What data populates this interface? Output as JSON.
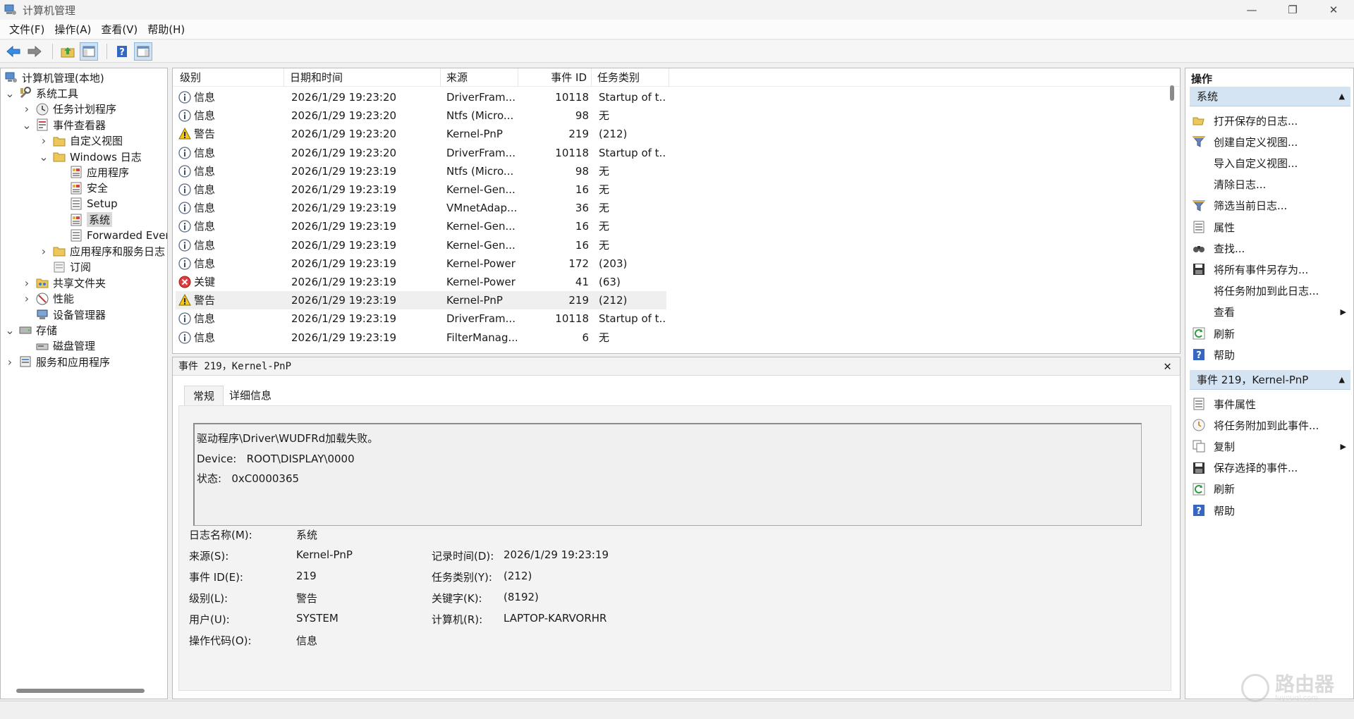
{
  "window": {
    "title": "计算机管理",
    "min": "—",
    "restore": "❐",
    "close": "✕"
  },
  "menu": [
    "文件(F)",
    "操作(A)",
    "查看(V)",
    "帮助(H)"
  ],
  "tree": [
    {
      "label": "计算机管理(本地)",
      "depth": 0,
      "chev": "",
      "icon": "computer-icon"
    },
    {
      "label": "系统工具",
      "depth": 0,
      "chev": "v",
      "icon": "tools-icon"
    },
    {
      "label": "任务计划程序",
      "depth": 1,
      "chev": ">",
      "icon": "clock-icon"
    },
    {
      "label": "事件查看器",
      "depth": 1,
      "chev": "v",
      "icon": "event-viewer-icon"
    },
    {
      "label": "自定义视图",
      "depth": 2,
      "chev": ">",
      "icon": "folder-icon"
    },
    {
      "label": "Windows 日志",
      "depth": 2,
      "chev": "v",
      "icon": "folder-icon"
    },
    {
      "label": "应用程序",
      "depth": 3,
      "chev": "",
      "icon": "log-icon"
    },
    {
      "label": "安全",
      "depth": 3,
      "chev": "",
      "icon": "log-icon"
    },
    {
      "label": "Setup",
      "depth": 3,
      "chev": "",
      "icon": "log-plain-icon"
    },
    {
      "label": "系统",
      "depth": 3,
      "chev": "",
      "icon": "log-icon",
      "selected": true
    },
    {
      "label": "Forwarded Even",
      "depth": 3,
      "chev": "",
      "icon": "log-plain-icon"
    },
    {
      "label": "应用程序和服务日志",
      "depth": 2,
      "chev": ">",
      "icon": "folder-icon"
    },
    {
      "label": "订阅",
      "depth": 2,
      "chev": "",
      "icon": "subscription-icon"
    },
    {
      "label": "共享文件夹",
      "depth": 1,
      "chev": ">",
      "icon": "shared-folder-icon"
    },
    {
      "label": "性能",
      "depth": 1,
      "chev": ">",
      "icon": "performance-icon"
    },
    {
      "label": "设备管理器",
      "depth": 1,
      "chev": "",
      "icon": "device-manager-icon"
    },
    {
      "label": "存储",
      "depth": 0,
      "chev": "v",
      "icon": "storage-icon"
    },
    {
      "label": "磁盘管理",
      "depth": 1,
      "chev": "",
      "icon": "disk-icon"
    },
    {
      "label": "服务和应用程序",
      "depth": 0,
      "chev": ">",
      "icon": "services-icon"
    }
  ],
  "grid": {
    "headers": [
      "级别",
      "日期和时间",
      "来源",
      "事件 ID",
      "任务类别"
    ],
    "rows": [
      {
        "level": "信息",
        "type": "info",
        "time": "2026/1/29 19:23:20",
        "source": "DriverFram...",
        "id": "10118",
        "task": "Startup of t..."
      },
      {
        "level": "信息",
        "type": "info",
        "time": "2026/1/29 19:23:20",
        "source": "Ntfs (Micro...",
        "id": "98",
        "task": "无"
      },
      {
        "level": "警告",
        "type": "warning",
        "time": "2026/1/29 19:23:20",
        "source": "Kernel-PnP",
        "id": "219",
        "task": "(212)"
      },
      {
        "level": "信息",
        "type": "info",
        "time": "2026/1/29 19:23:20",
        "source": "DriverFram...",
        "id": "10118",
        "task": "Startup of t..."
      },
      {
        "level": "信息",
        "type": "info",
        "time": "2026/1/29 19:23:19",
        "source": "Ntfs (Micro...",
        "id": "98",
        "task": "无"
      },
      {
        "level": "信息",
        "type": "info",
        "time": "2026/1/29 19:23:19",
        "source": "Kernel-Gen...",
        "id": "16",
        "task": "无"
      },
      {
        "level": "信息",
        "type": "info",
        "time": "2026/1/29 19:23:19",
        "source": "VMnetAdap...",
        "id": "36",
        "task": "无"
      },
      {
        "level": "信息",
        "type": "info",
        "time": "2026/1/29 19:23:19",
        "source": "Kernel-Gen...",
        "id": "16",
        "task": "无"
      },
      {
        "level": "信息",
        "type": "info",
        "time": "2026/1/29 19:23:19",
        "source": "Kernel-Gen...",
        "id": "16",
        "task": "无"
      },
      {
        "level": "信息",
        "type": "info",
        "time": "2026/1/29 19:23:19",
        "source": "Kernel-Power",
        "id": "172",
        "task": "(203)"
      },
      {
        "level": "关键",
        "type": "critical",
        "time": "2026/1/29 19:23:19",
        "source": "Kernel-Power",
        "id": "41",
        "task": "(63)"
      },
      {
        "level": "警告",
        "type": "warning",
        "time": "2026/1/29 19:23:19",
        "source": "Kernel-PnP",
        "id": "219",
        "task": "(212)",
        "highlight": true
      },
      {
        "level": "信息",
        "type": "info",
        "time": "2026/1/29 19:23:19",
        "source": "DriverFram...",
        "id": "10118",
        "task": "Startup of t..."
      },
      {
        "level": "信息",
        "type": "info",
        "time": "2026/1/29 19:23:19",
        "source": "FilterManag...",
        "id": "6",
        "task": "无"
      }
    ]
  },
  "detail": {
    "header": "事件 219，Kernel-PnP",
    "tabs": [
      "常规",
      "详细信息"
    ],
    "message": [
      "驱动程序\\Driver\\WUDFRd加载失败。",
      "Device:   ROOT\\DISPLAY\\0000",
      "状态:   0xC0000365"
    ],
    "fields_left": [
      {
        "k": "日志名称(M):",
        "v": "系统"
      },
      {
        "k": "来源(S):",
        "v": "Kernel-PnP"
      },
      {
        "k": "事件 ID(E):",
        "v": "219"
      },
      {
        "k": "级别(L):",
        "v": "警告"
      },
      {
        "k": "用户(U):",
        "v": "SYSTEM"
      },
      {
        "k": "操作代码(O):",
        "v": "信息"
      }
    ],
    "fields_right": [
      {
        "k": "记录时间(D):",
        "v": "2026/1/29 19:23:19"
      },
      {
        "k": "任务类别(Y):",
        "v": "(212)"
      },
      {
        "k": "关键字(K):",
        "v": "(8192)"
      },
      {
        "k": "计算机(R):",
        "v": "LAPTOP-KARVORHR"
      }
    ]
  },
  "actions": {
    "title": "操作",
    "section1": "系统",
    "items1": [
      {
        "label": "打开保存的日志...",
        "icon": "open-folder-icon"
      },
      {
        "label": "创建自定义视图...",
        "icon": "filter-icon"
      },
      {
        "label": "导入自定义视图...",
        "icon": ""
      },
      {
        "label": "清除日志...",
        "icon": ""
      },
      {
        "label": "筛选当前日志...",
        "icon": "filter-icon"
      },
      {
        "label": "属性",
        "icon": "properties-icon"
      },
      {
        "label": "查找...",
        "icon": "binoculars-icon"
      },
      {
        "label": "将所有事件另存为...",
        "icon": "save-icon"
      },
      {
        "label": "将任务附加到此日志...",
        "icon": ""
      },
      {
        "label": "查看",
        "icon": "",
        "sub": true
      },
      {
        "label": "刷新",
        "icon": "refresh-icon"
      },
      {
        "label": "帮助",
        "icon": "help-icon"
      }
    ],
    "section2": "事件 219，Kernel-PnP",
    "items2": [
      {
        "label": "事件属性",
        "icon": "properties-icon"
      },
      {
        "label": "将任务附加到此事件...",
        "icon": "task-icon"
      },
      {
        "label": "复制",
        "icon": "copy-icon",
        "sub": true
      },
      {
        "label": "保存选择的事件...",
        "icon": "save-icon"
      },
      {
        "label": "刷新",
        "icon": "refresh-icon"
      },
      {
        "label": "帮助",
        "icon": "help-icon"
      }
    ]
  },
  "watermark": {
    "text": "路由器",
    "sub": "luyouqi.com"
  }
}
